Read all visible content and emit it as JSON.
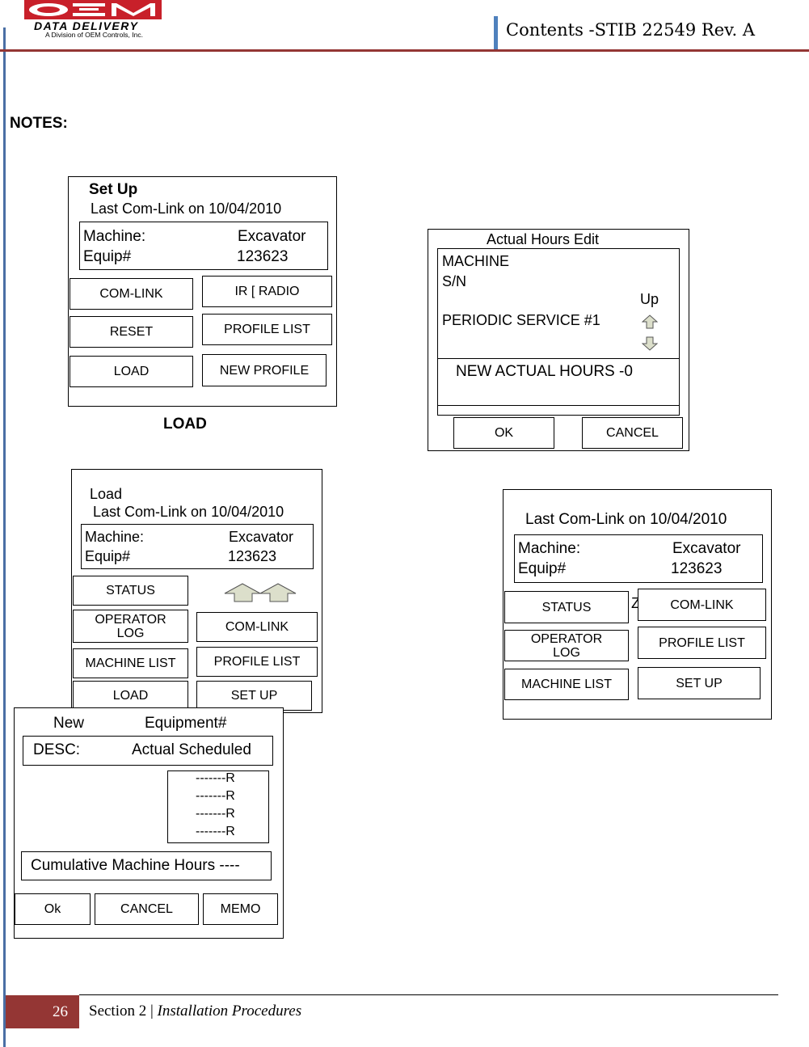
{
  "header": {
    "logo": {
      "brand": "OEM",
      "subtitle": "DATA DELIVERY",
      "tagline": "A Division of OEM Controls, Inc."
    },
    "title": "Contents -STIB 22549 Rev. A"
  },
  "notes_heading": "NOTES:",
  "setup_screen": {
    "title": "Set Up",
    "last_comlink": "Last Com-Link on 10/04/2010",
    "machine_label": "Machine:",
    "machine_value": "Excavator",
    "equip_label": "Equip#",
    "equip_value": "123623",
    "buttons": [
      "COM-LINK",
      "IR [ RADIO",
      "RESET",
      "PROFILE LIST",
      "LOAD",
      "NEW PROFILE"
    ]
  },
  "load_caption": "LOAD",
  "hours_edit_screen": {
    "title": "Actual Hours Edit",
    "line1": "MACHINE",
    "line2": "S/N",
    "up_label": "Up",
    "service": "PERIODIC SERVICE #1",
    "new_hours": "NEW ACTUAL HOURS -0",
    "ok": "OK",
    "cancel": "CANCEL"
  },
  "load_screen": {
    "title": "Load",
    "last_comlink": "Last Com-Link on 10/04/2010",
    "machine_label": "Machine:",
    "machine_value": "Excavator",
    "equip_label": "Equip#",
    "equip_value": "123623",
    "buttons": [
      "STATUS",
      "OPERATOR LOG",
      "COM-LINK",
      "MACHINE LIST",
      "PROFILE LIST",
      "LOAD",
      "SET UP"
    ]
  },
  "main_screen": {
    "last_comlink": "Last Com-Link on 10/04/2010",
    "machine_label": "Machine:",
    "machine_value": "Excavator",
    "equip_label": "Equip#",
    "equip_value": "123623",
    "stray_char": "Z",
    "buttons": [
      "STATUS",
      "COM-LINK",
      "OPERATOR LOG",
      "PROFILE LIST",
      "MACHINE LIST",
      "SET UP"
    ]
  },
  "new_equipment_screen": {
    "title_left": "New",
    "title_right": "Equipment#",
    "desc_label": "DESC:",
    "desc_columns": "Actual Scheduled",
    "rows": [
      "-------R",
      "-------R",
      "-------R",
      "-------R"
    ],
    "cumulative": "Cumulative Machine Hours ----",
    "ok": "Ok",
    "cancel": "CANCEL",
    "memo": "MEMO"
  },
  "footer": {
    "page_number": "26",
    "section": "Section 2 | ",
    "section_title": "Installation Procedures"
  },
  "colors": {
    "accent_red": "#943634",
    "accent_blue": "#4f81bd",
    "arrow_fill": "#dcdfcb"
  }
}
